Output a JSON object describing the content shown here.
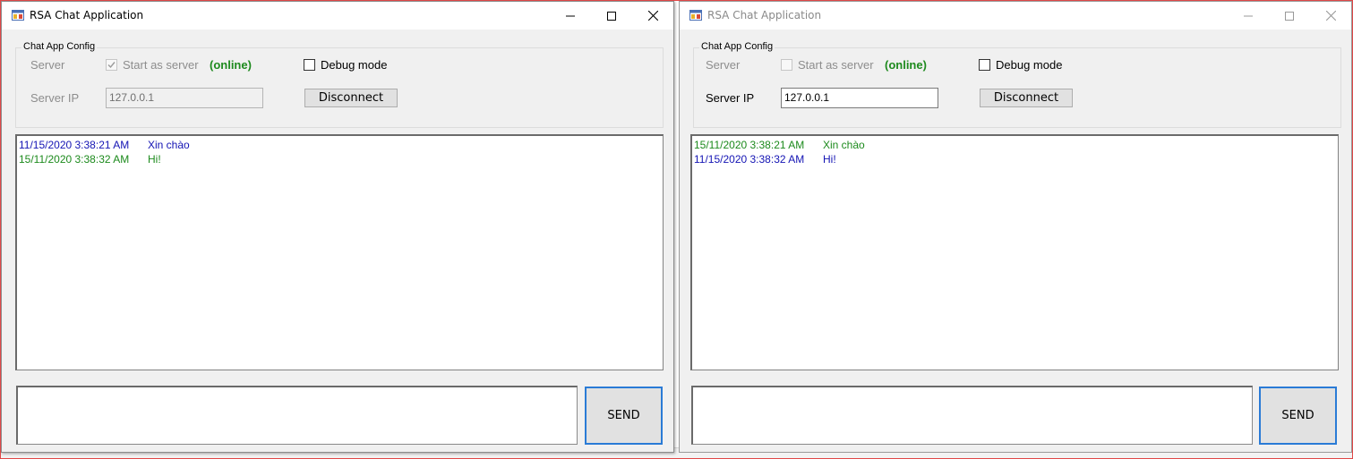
{
  "windows": [
    {
      "title": "RSA Chat Application",
      "config": {
        "group_title": "Chat App Config",
        "server_label": "Server",
        "start_as_server_label": "Start as server",
        "start_as_server_checked": true,
        "status": "(online)",
        "debug_label": "Debug mode",
        "server_ip_label": "Server IP",
        "server_ip_value": "127.0.0.1",
        "disconnect_label": "Disconnect"
      },
      "messages": [
        {
          "timestamp": "11/15/2020 3:38:21 AM",
          "text": "Xin chào",
          "color": "blue"
        },
        {
          "timestamp": "15/11/2020 3:38:32 AM",
          "text": "Hi!",
          "color": "green"
        }
      ],
      "input_value": "",
      "send_label": "SEND"
    },
    {
      "title": "RSA Chat Application",
      "config": {
        "group_title": "Chat App Config",
        "server_label": "Server",
        "start_as_server_label": "Start as server",
        "start_as_server_checked": false,
        "status": "(online)",
        "debug_label": "Debug mode",
        "server_ip_label": "Server IP",
        "server_ip_value": "127.0.0.1",
        "disconnect_label": "Disconnect"
      },
      "messages": [
        {
          "timestamp": "15/11/2020 3:38:21 AM",
          "text": "Xin chào",
          "color": "green"
        },
        {
          "timestamp": "11/15/2020 3:38:32 AM",
          "text": "Hi!",
          "color": "blue"
        }
      ],
      "input_value": "",
      "send_label": "SEND"
    }
  ],
  "colors": {
    "blue": "#1414b4",
    "green": "#1c8a1c",
    "online": "#1e8a1e",
    "send_focus_border": "#2a7bd6"
  },
  "icons": {
    "app": "app-window-icon",
    "minimize": "minimize-icon",
    "maximize": "maximize-icon",
    "close": "close-icon",
    "check": "checkmark-icon"
  }
}
